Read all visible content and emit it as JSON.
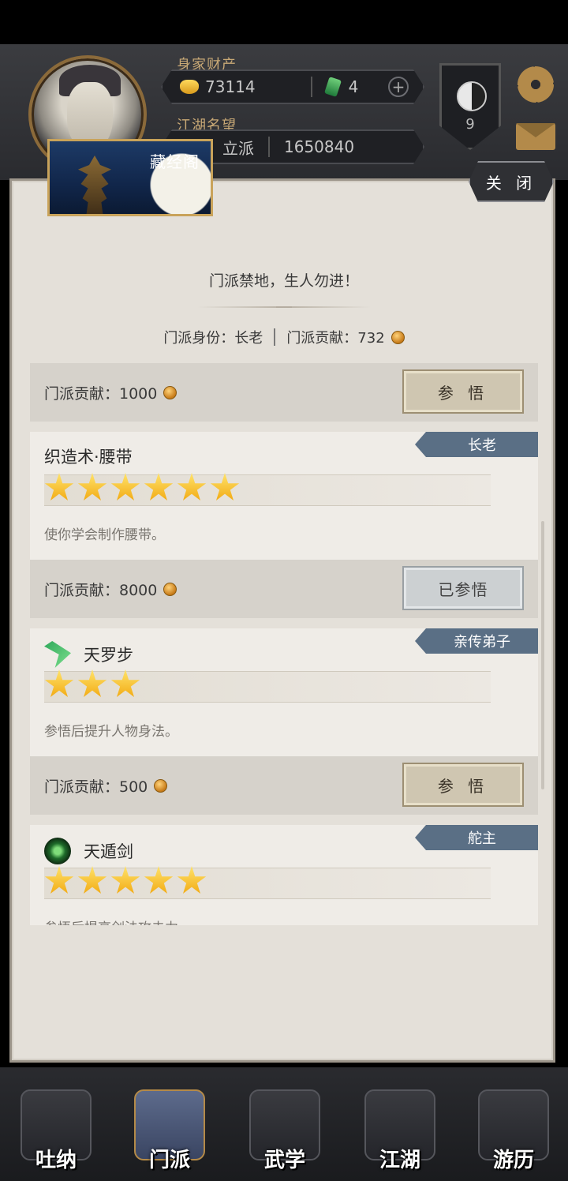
{
  "header": {
    "wealth_label": "身家财产",
    "gold_amount": "73114",
    "jade_amount": "4",
    "reputation_label": "江湖名望",
    "sect_status": "立派",
    "reputation_value": "1650840",
    "emblem_level": "9"
  },
  "scene": {
    "title": "藏经阁",
    "close_label": "关 闭"
  },
  "intro": {
    "motto": "门派禁地，生人勿进！",
    "identity_label": "门派身份：长老",
    "contribution_label": "门派贡献：732"
  },
  "rows": [
    {
      "cost": "门派贡献：1000",
      "button": "参 悟"
    },
    {
      "tag": "长老",
      "name": "织造术·腰带",
      "stars": 6,
      "desc": "使你学会制作腰带。",
      "cost": "门派贡献：8000",
      "button": "已参悟"
    },
    {
      "tag": "亲传弟子",
      "name": "天罗步",
      "stars": 3,
      "desc": "参悟后提升人物身法。",
      "cost": "门派贡献：500",
      "button": "参 悟"
    },
    {
      "tag": "舵主",
      "name": "天遁剑",
      "stars": 5,
      "desc": "参悟后提高剑法攻击力"
    }
  ],
  "nav": [
    {
      "label": "吐纳"
    },
    {
      "label": "门派"
    },
    {
      "label": "武学"
    },
    {
      "label": "江湖"
    },
    {
      "label": "游历"
    }
  ],
  "colors": {
    "tag_bg": "#5a6f85",
    "panel_bg": "#e4e0d9",
    "star": "#f5b81f"
  }
}
